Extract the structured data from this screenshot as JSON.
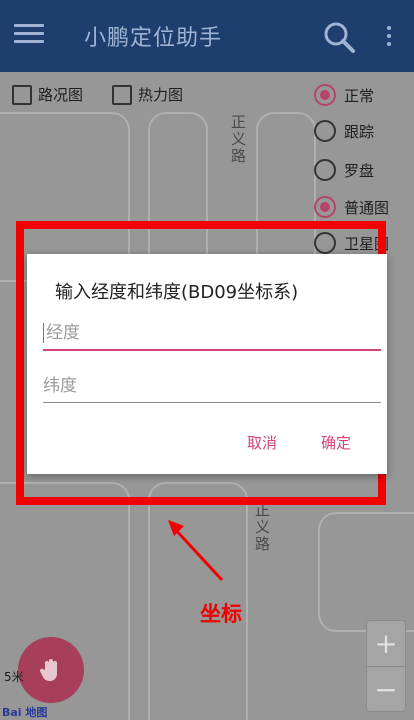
{
  "appbar": {
    "title": "小鹏定位助手"
  },
  "layers": {
    "traffic": "路况图",
    "heat": "热力图"
  },
  "modes": {
    "normal": "正常",
    "follow": "跟踪",
    "compass": "罗盘"
  },
  "map_types": {
    "standard": "普通图",
    "satellite": "卫星图"
  },
  "roads": {
    "top": "正义路",
    "bottom": "正义路"
  },
  "dialog": {
    "title": "输入经度和纬度(BD09坐标系)",
    "longitude_placeholder": "经度",
    "latitude_placeholder": "纬度",
    "cancel": "取消",
    "ok": "确定"
  },
  "zoom": {
    "in": "+",
    "out": "−"
  },
  "scale": "5米",
  "logo": "Bai 地图",
  "annotation": "坐标",
  "colors": {
    "appbar": "#1e3f6e",
    "accent": "#d2437a",
    "highlight_frame": "#f20000"
  }
}
